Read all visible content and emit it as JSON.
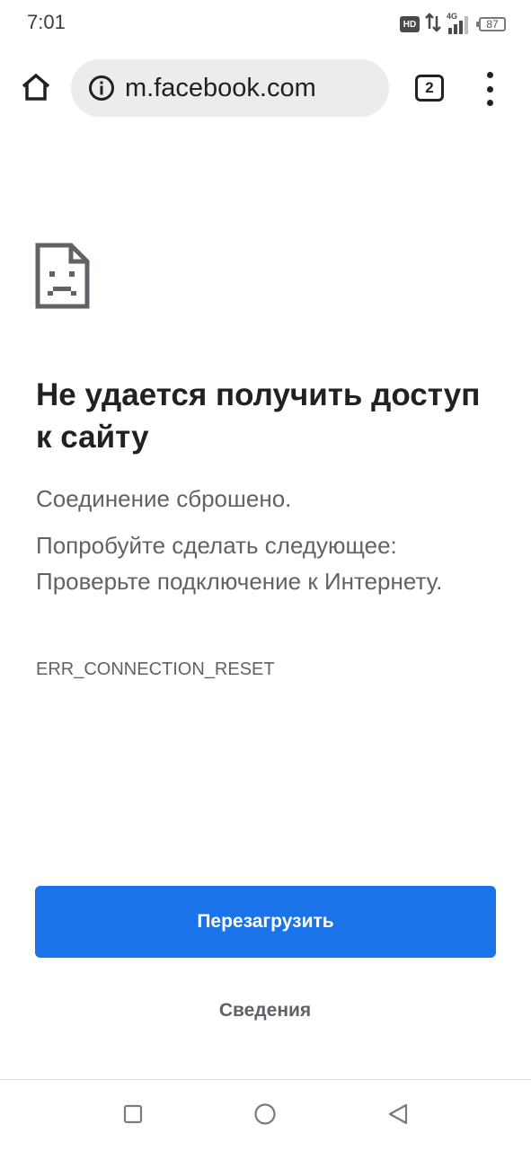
{
  "status_bar": {
    "time": "7:01",
    "hd_label": "HD",
    "network_label": "4G",
    "battery_level": "87"
  },
  "toolbar": {
    "url": "m.facebook.com",
    "tab_count": "2"
  },
  "error": {
    "title": "Не удается получить доступ к сайту",
    "connection_message": "Соединение сброшено.",
    "suggestion": "Попробуйте сделать следующее: Проверьте подключение к Интернету.",
    "error_code": "ERR_CONNECTION_RESET"
  },
  "actions": {
    "reload_label": "Перезагрузить",
    "details_label": "Сведения"
  },
  "colors": {
    "primary_button": "#1a73e8",
    "title_text": "#202124",
    "body_text": "#5f6368",
    "url_bar_bg": "#ececec"
  },
  "icons": {
    "home": "home-icon",
    "info": "info-icon",
    "tabs": "tab-switcher-icon",
    "menu": "more-vert-icon",
    "error": "sad-page-icon",
    "nav_recents": "square-icon",
    "nav_home": "circle-icon",
    "nav_back": "triangle-back-icon"
  }
}
